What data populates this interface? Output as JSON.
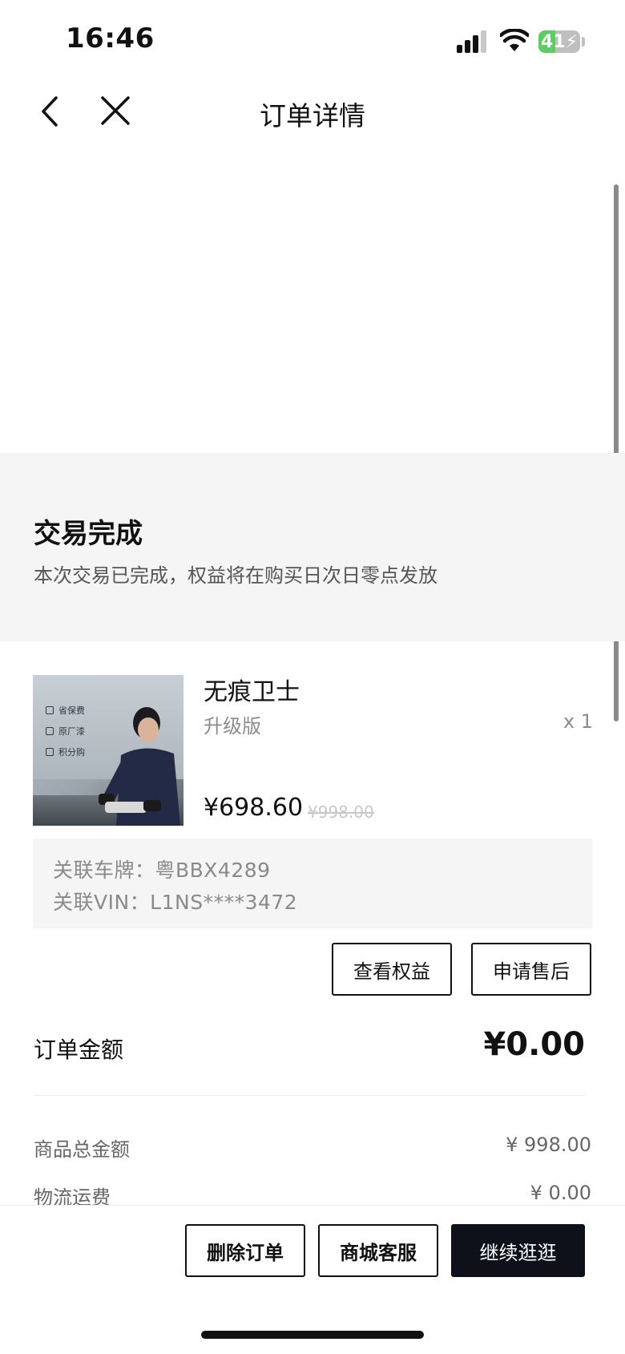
{
  "status_bar": {
    "time": "16:46",
    "battery_level": "41",
    "battery_fraction": 0.41,
    "battery_color": "#5fcb64",
    "icons": [
      "cellular-signal-icon",
      "wifi-icon",
      "battery-charging-icon"
    ]
  },
  "nav": {
    "title": "订单详情",
    "icons": [
      "chevron-left-icon",
      "close-icon"
    ]
  },
  "order_status": {
    "title": "交易完成",
    "description": "本次交易已完成，权益将在购买日次日零点发放"
  },
  "product": {
    "name": "无痕卫士",
    "spec": "升级版",
    "quantity": "x 1",
    "price": "¥698.60",
    "original_price": "¥998.00",
    "image_tags": [
      "省保费",
      "原厂漆",
      "积分购"
    ]
  },
  "vehicle_info": {
    "plate": "关联车牌：粤BBX4289",
    "vin": "关联VIN：L1NS****3472"
  },
  "item_actions": {
    "view_benefits": "查看权益",
    "after_sale": "申请售后"
  },
  "summary": {
    "total_label": "订单金额",
    "total_value": "¥0.00",
    "rows": [
      {
        "label": "商品总金额",
        "value": "¥ 998.00"
      },
      {
        "label": "物流运费",
        "value": "¥ 0.00"
      }
    ]
  },
  "bottom_bar": {
    "delete_label": "删除订单",
    "service_label": "商城客服",
    "continue_label": "继续逛逛",
    "primary_color": "#0e111a"
  }
}
